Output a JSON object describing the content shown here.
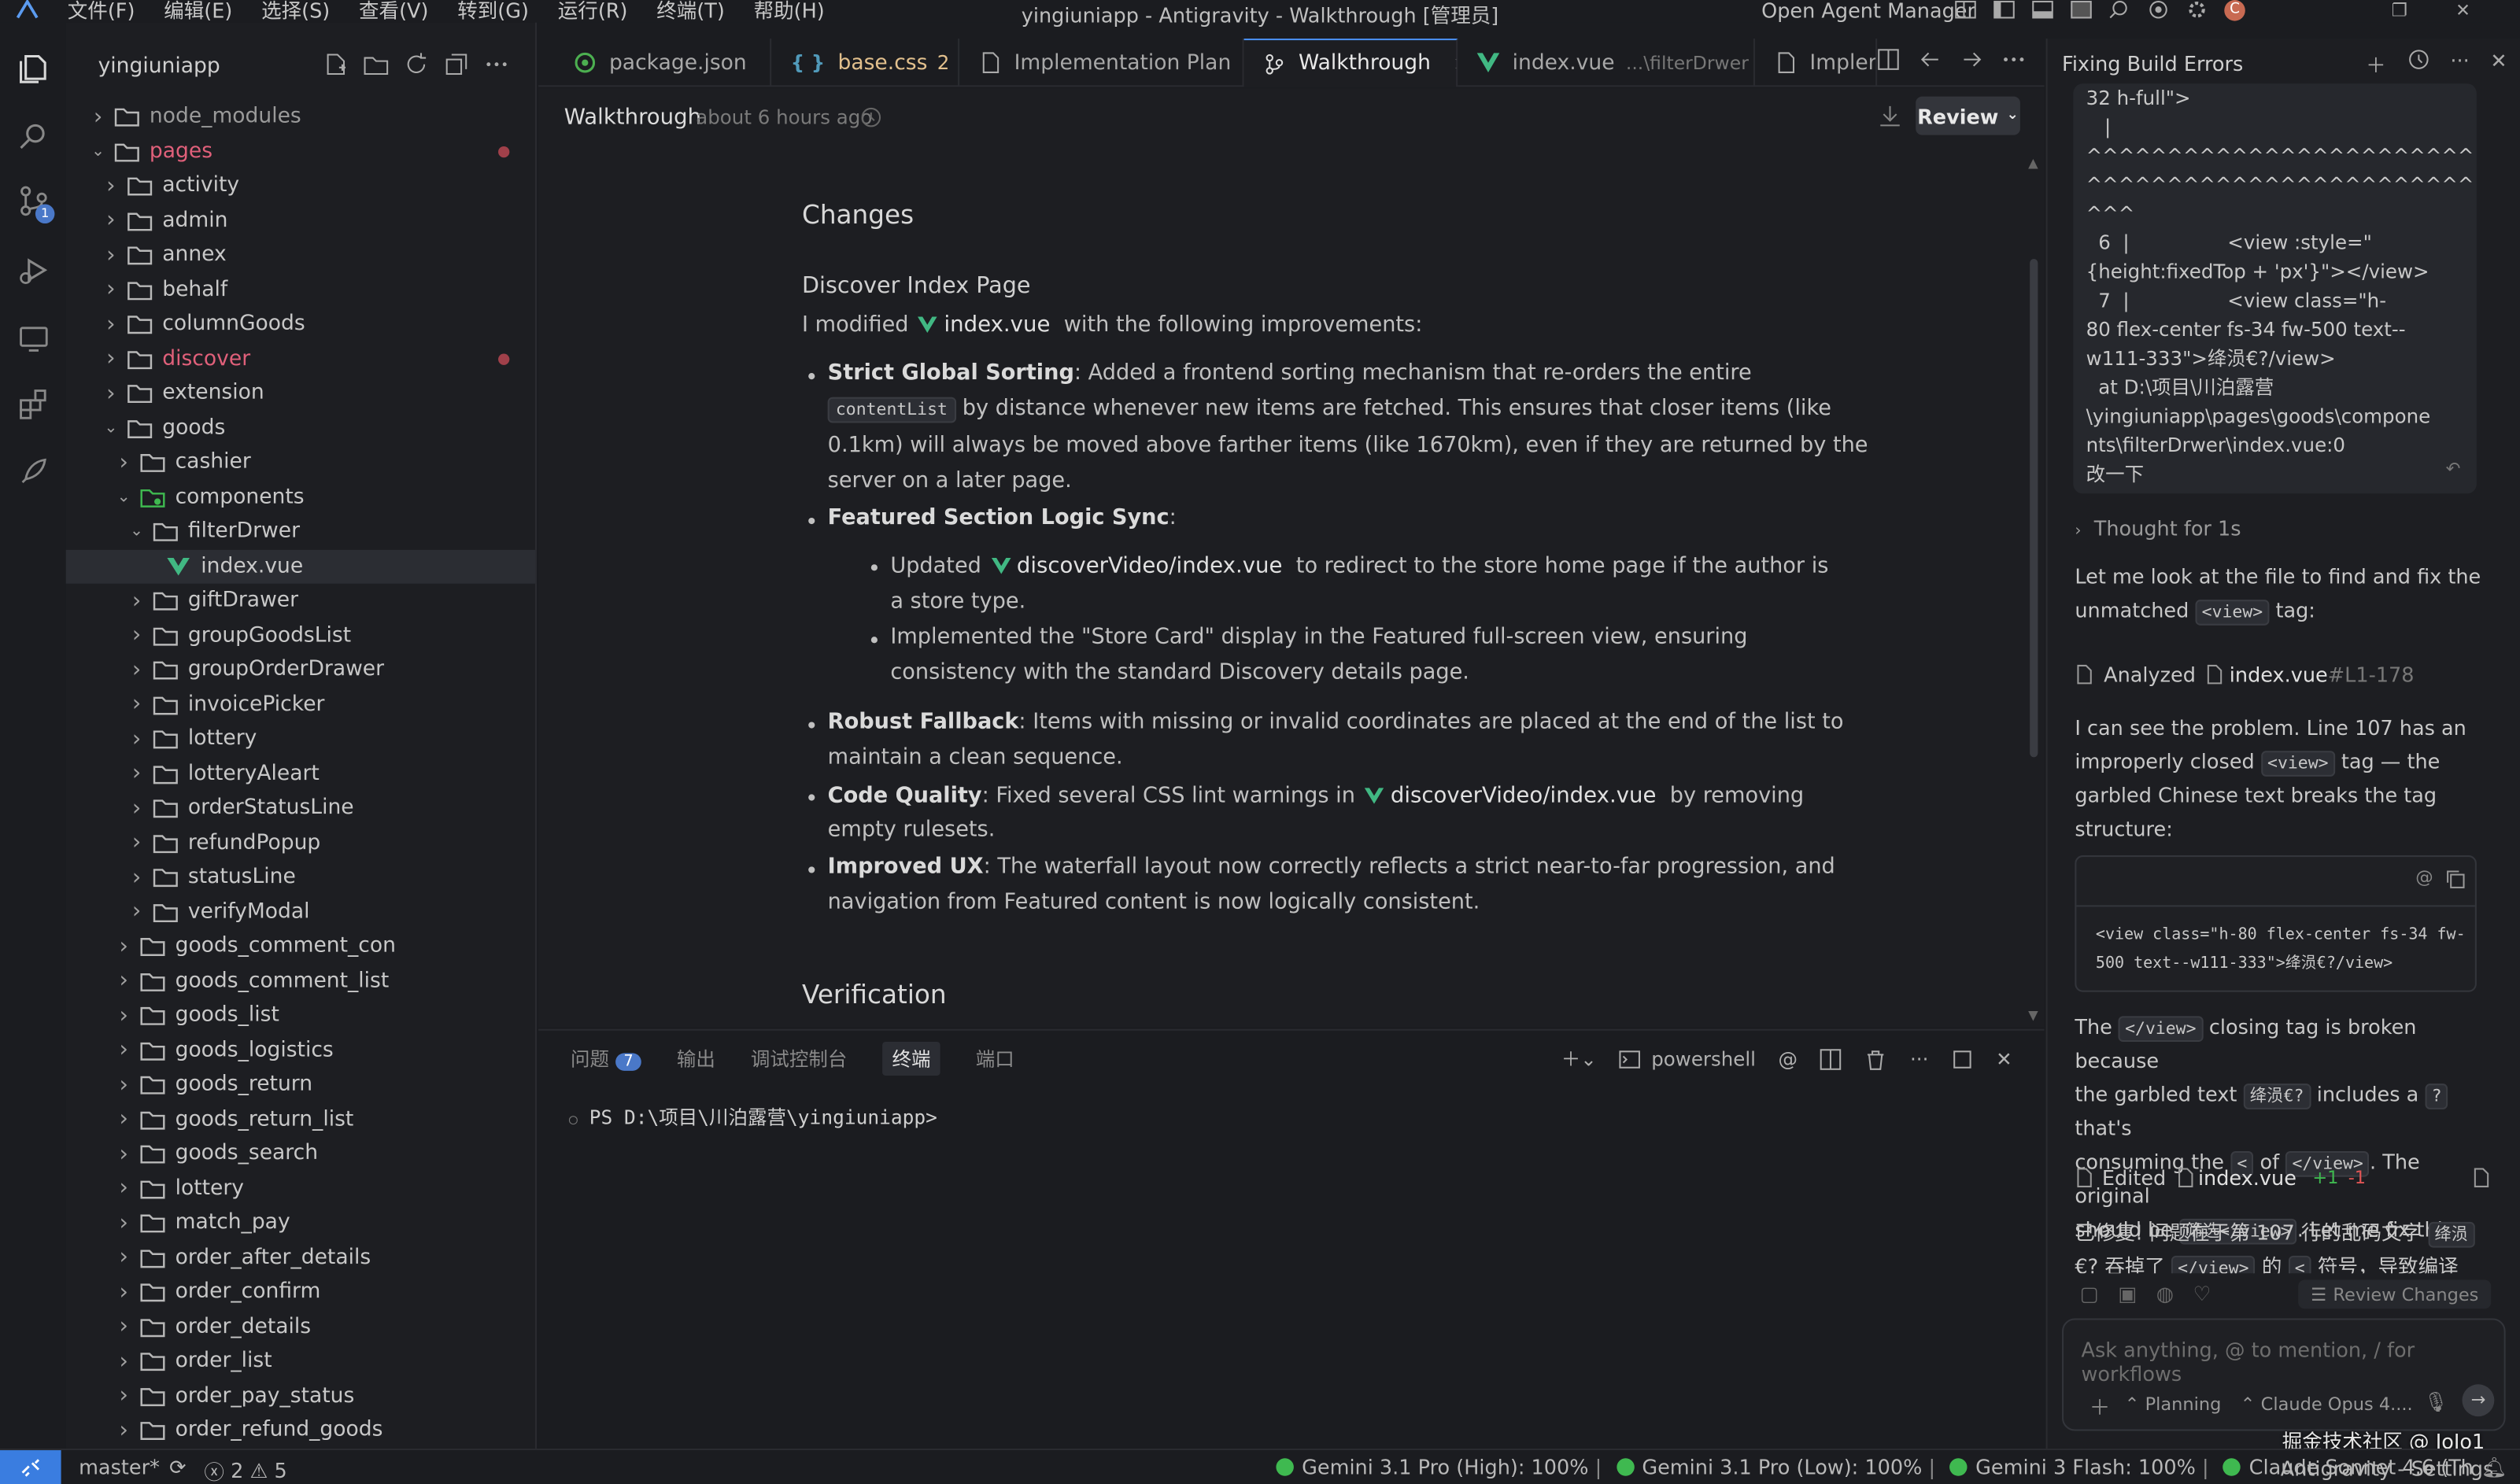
{
  "window": {
    "title": "yingiuniapp - Antigravity - Walkthrough [管理员]",
    "menu": [
      "文件(F)",
      "编辑(E)",
      "选择(S)",
      "查看(V)",
      "转到(G)",
      "运行(R)",
      "终端(T)",
      "帮助(H)"
    ],
    "agent_manager_label": "Open Agent Manager"
  },
  "explorer": {
    "title": "yingiuniapp",
    "tree": [
      {
        "label": "node_modules",
        "depth": 0,
        "open": false,
        "color": "#9a9a9a"
      },
      {
        "label": "pages",
        "depth": 0,
        "open": true,
        "color": "#e0607a",
        "modified": true
      },
      {
        "label": "activity",
        "depth": 1,
        "open": false
      },
      {
        "label": "admin",
        "depth": 1,
        "open": false
      },
      {
        "label": "annex",
        "depth": 1,
        "open": false
      },
      {
        "label": "behalf",
        "depth": 1,
        "open": false
      },
      {
        "label": "columnGoods",
        "depth": 1,
        "open": false
      },
      {
        "label": "discover",
        "depth": 1,
        "open": false,
        "color": "#e0607a",
        "modified": true
      },
      {
        "label": "extension",
        "depth": 1,
        "open": false
      },
      {
        "label": "goods",
        "depth": 1,
        "open": true
      },
      {
        "label": "cashier",
        "depth": 2,
        "open": false
      },
      {
        "label": "components",
        "depth": 2,
        "open": true,
        "special": true
      },
      {
        "label": "filterDrwer",
        "depth": 3,
        "open": true
      },
      {
        "label": "index.vue",
        "depth": 4,
        "file": true,
        "selected": true
      },
      {
        "label": "giftDrawer",
        "depth": 3,
        "open": false
      },
      {
        "label": "groupGoodsList",
        "depth": 3,
        "open": false
      },
      {
        "label": "groupOrderDrawer",
        "depth": 3,
        "open": false
      },
      {
        "label": "invoicePicker",
        "depth": 3,
        "open": false
      },
      {
        "label": "lottery",
        "depth": 3,
        "open": false
      },
      {
        "label": "lotteryAleart",
        "depth": 3,
        "open": false
      },
      {
        "label": "orderStatusLine",
        "depth": 3,
        "open": false
      },
      {
        "label": "refundPopup",
        "depth": 3,
        "open": false
      },
      {
        "label": "statusLine",
        "depth": 3,
        "open": false
      },
      {
        "label": "verifyModal",
        "depth": 3,
        "open": false
      },
      {
        "label": "goods_comment_con",
        "depth": 2,
        "open": false
      },
      {
        "label": "goods_comment_list",
        "depth": 2,
        "open": false
      },
      {
        "label": "goods_list",
        "depth": 2,
        "open": false
      },
      {
        "label": "goods_logistics",
        "depth": 2,
        "open": false
      },
      {
        "label": "goods_return",
        "depth": 2,
        "open": false
      },
      {
        "label": "goods_return_list",
        "depth": 2,
        "open": false
      },
      {
        "label": "goods_search",
        "depth": 2,
        "open": false
      },
      {
        "label": "lottery",
        "depth": 2,
        "open": false
      },
      {
        "label": "match_pay",
        "depth": 2,
        "open": false
      },
      {
        "label": "order_after_details",
        "depth": 2,
        "open": false
      },
      {
        "label": "order_confirm",
        "depth": 2,
        "open": false
      },
      {
        "label": "order_details",
        "depth": 2,
        "open": false
      },
      {
        "label": "order_list",
        "depth": 2,
        "open": false
      },
      {
        "label": "order_pay_status",
        "depth": 2,
        "open": false
      },
      {
        "label": "order_refund_goods",
        "depth": 2,
        "open": false
      }
    ]
  },
  "tabs": [
    {
      "label": "package.json",
      "icon": "package-icon",
      "badge": "",
      "suffix": ""
    },
    {
      "label": "base.css",
      "icon": "css-icon",
      "badge": "2",
      "suffix": ""
    },
    {
      "label": "Implementation Plan",
      "icon": "doc-icon",
      "badge": "",
      "suffix": ""
    },
    {
      "label": "Walkthrough",
      "icon": "walkthrough-icon",
      "badge": "",
      "suffix": "",
      "active": true
    },
    {
      "label": "index.vue",
      "icon": "vue-icon",
      "badge": "",
      "suffix": "...\\filterDrwer"
    },
    {
      "label": "Impler",
      "icon": "doc-icon",
      "badge": "",
      "suffix": ""
    }
  ],
  "doc": {
    "title": "Walkthrough",
    "time": "about 6 hours ago",
    "review_label": "Review",
    "changes_heading": "Changes",
    "section_heading": "Discover Index Page",
    "intro_pre": "I modified",
    "intro_file": "index.vue",
    "intro_post": "with the following improvements:",
    "b1_title": "Strict Global Sorting",
    "b1_text1": ": Added a frontend sorting mechanism that re-orders the entire",
    "b1_code": "contentList",
    "b1_text2": "by distance whenever new items are fetched. This ensures that closer items (like",
    "b1_text3": "0.1km) will always be moved above farther items (like 1670km), even if they are returned by the",
    "b1_text4": "server on a later page.",
    "b2_title": "Featured Section Logic Sync",
    "b2_colon": ":",
    "b2a_pre": "Updated",
    "b2a_file": "discoverVideo/index.vue",
    "b2a_post": "to redirect to the store home page if the author is",
    "b2a_post2": "a store type.",
    "b2b_1": "Implemented the \"Store Card\" display in the Featured full-screen view, ensuring",
    "b2b_2": "consistency with the standard Discovery details page.",
    "b3_title": "Robust Fallback",
    "b3_text1": ": Items with missing or invalid coordinates are placed at the end of the list to",
    "b3_text2": "maintain a clean sequence.",
    "b4_title": "Code Quality",
    "b4_pre": ": Fixed several CSS lint warnings in",
    "b4_file": "discoverVideo/index.vue",
    "b4_post": "by removing",
    "b4_post2": "empty rulesets.",
    "b5_title": "Improved UX",
    "b5_text1": ": The waterfall layout now correctly reflects a strict near-to-far progression, and",
    "b5_text2": "navigation from Featured content is now logically consistent.",
    "verification_heading": "Verification"
  },
  "panel": {
    "tabs": [
      "问题",
      "输出",
      "调试控制台",
      "终端",
      "端口"
    ],
    "problems_count": "7",
    "shell": "powershell",
    "prompt": "PS D:\\项目\\川泊露营\\yingiuniapp>"
  },
  "chat": {
    "title": "Fixing Build Errors",
    "user_lines": [
      "32 h-full\">",
      "   |",
      "^^^^^^^^^^^^^^^^^^^^^^^^",
      "^^^^^^^^^^^^^^^^^^^^^^^^",
      "^^^",
      "  6  |                <view :style=\"",
      "{height:fixedTop + 'px'}\"></view>",
      "  7  |                <view class=\"h-",
      "80 flex-center fs-34 fw-500 text--",
      "w111-333\">绛涢€?/view>",
      "  at D:\\项目\\川泊露营",
      "\\yingiuniapp\\pages\\goods\\compone",
      "nts\\filterDrwer\\index.vue:0",
      "改一下"
    ],
    "thought": "Thought for 1s",
    "m1_pre": "Let me look at the file to find and fix the",
    "m1_pre2": "unmatched",
    "m1_code": "<view>",
    "m1_post": "tag:",
    "analyzed_label": "Analyzed",
    "analyzed_file": "index.vue",
    "analyzed_range": "#L1-178",
    "m2_1": "I can see the problem. Line 107 has an",
    "m2_2": "improperly closed",
    "m2_code": "<view>",
    "m2_3": "tag — the",
    "m2_4": "garbled Chinese text breaks the tag",
    "m2_5": "structure:",
    "code_line1": "<view class=\"h-80 flex-center fs-34 fw-",
    "code_line2": "500 text--w111-333\">绛涢€?/view>",
    "m3_1a": "The",
    "m3_1code": "</view>",
    "m3_1b": "closing tag is broken because",
    "m3_2a": "the garbled text",
    "m3_2code": "绛涢€?",
    "m3_2b": "includes a",
    "m3_2code2": "?",
    "m3_2c": "that's",
    "m3_3a": "consuming the",
    "m3_3code": "<",
    "m3_3b": "of",
    "m3_3code2": "</view>",
    "m3_3c": ". The original",
    "m3_4a": "should be",
    "m3_4code": "筛选</view>",
    "m3_4b": ". Let me fix this:",
    "edited_label": "Edited",
    "edited_file": "index.vue",
    "edited_add": "+1",
    "edited_del": "-1",
    "m4_1": "已修复! 问题在于第 107 行的乱码文字",
    "m4_code": "绛涢",
    "m4_2": "€? 吞掉了",
    "m4_code2": "</view>",
    "m4_3": "的",
    "m4_code3": "<",
    "m4_4": "符号，导致编译",
    "review_changes": "Review Changes",
    "input_placeholder": "Ask anything, @ to mention, / for workflows",
    "mode": "Planning",
    "model": "Claude Opus 4...."
  },
  "status": {
    "branch": "master*",
    "errors": "2",
    "warnings": "5",
    "quotas": [
      "Gemini 3.1 Pro (High): 100%",
      "Gemini 3.1 Pro (Low): 100%",
      "Gemini 3 Flash: 100%",
      "Claude Sonnet 4.6 (Th"
    ],
    "right": "Antigravity - Settings",
    "watermark": "掘金技术社区 @ JoJo1"
  }
}
